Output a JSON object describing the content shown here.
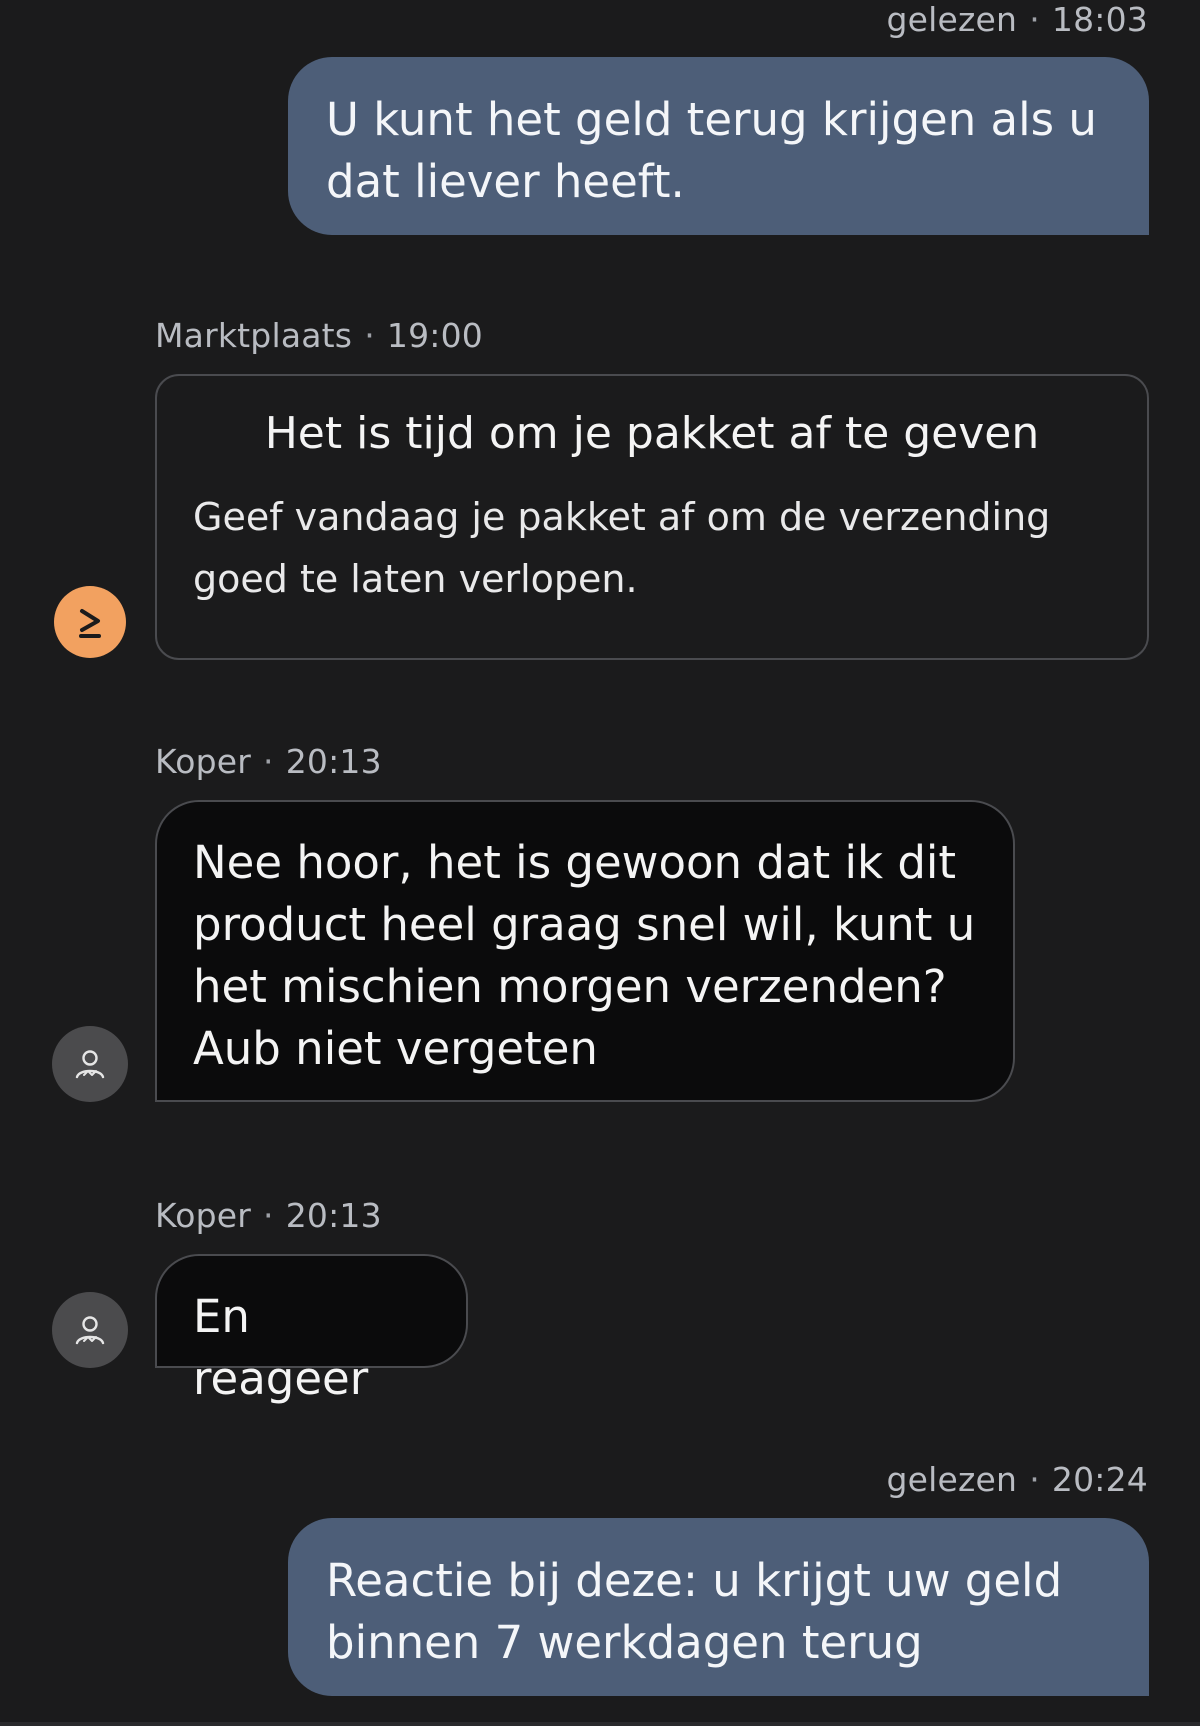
{
  "messages": [
    {
      "type": "outgoing",
      "status": "gelezen",
      "time": "18:03",
      "lines": [
        "U kunt het geld terug krijgen als u",
        "dat liever heeft."
      ]
    },
    {
      "type": "system",
      "sender": "Marktplaats",
      "time": "19:00",
      "title": "Het is tijd om je pakket af te geven",
      "lines": [
        "Geef vandaag je pakket af om de verzending",
        "goed te laten verlopen."
      ],
      "avatar_icon": "marktplaats-logo-icon"
    },
    {
      "type": "incoming",
      "sender": "Koper",
      "time": "20:13",
      "lines": [
        "Nee hoor, het is gewoon dat ik dit",
        "product heel graag snel wil, kunt u",
        "het mischien morgen verzenden?",
        "Aub niet vergeten"
      ],
      "avatar_icon": "user-icon"
    },
    {
      "type": "incoming",
      "sender": "Koper",
      "time": "20:13",
      "lines": [
        "En reageer"
      ],
      "avatar_icon": "user-icon"
    },
    {
      "type": "outgoing",
      "status": "gelezen",
      "time": "20:24",
      "lines": [
        "Reactie bij deze: u krijgt uw geld",
        "binnen 7 werkdagen terug"
      ]
    }
  ],
  "separator": "·",
  "colors": {
    "background": "#1b1b1c",
    "outgoing_bubble": "#4d5e78",
    "incoming_bubble": "#0b0b0c",
    "border": "#4a4b4f",
    "brand_avatar": "#f2a160",
    "user_avatar": "#4b4b4d"
  }
}
